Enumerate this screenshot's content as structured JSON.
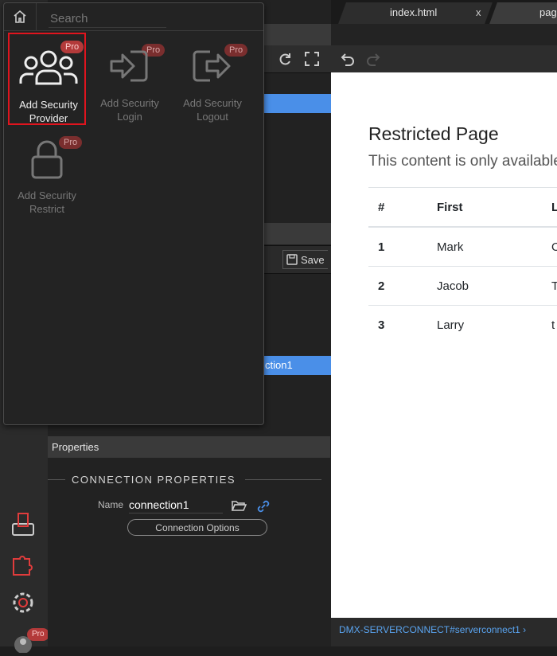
{
  "popup": {
    "search_placeholder": "Search",
    "pro_badge": "Pro",
    "tiles": [
      {
        "label_line1": "Add Security",
        "label_line2": "Provider",
        "icon": "users-icon",
        "active": true
      },
      {
        "label_line1": "Add Security",
        "label_line2": "Login",
        "icon": "login-icon",
        "active": false
      },
      {
        "label_line1": "Add Security",
        "label_line2": "Logout",
        "icon": "logout-icon",
        "active": false
      },
      {
        "label_line1": "Add Security",
        "label_line2": "Restrict",
        "icon": "lock-icon",
        "active": false
      }
    ]
  },
  "tabs": [
    {
      "label": "index.html",
      "close": "x"
    },
    {
      "label": "pag"
    }
  ],
  "background": {
    "save_label": "Save",
    "selected_item": "ction1"
  },
  "properties": {
    "header": "Properties",
    "section_title": "CONNECTION PROPERTIES",
    "name_label": "Name",
    "name_value": "connection1",
    "options_button": "Connection Options"
  },
  "canvas": {
    "heading": "Restricted Page",
    "lead": "This content is only available",
    "columns": [
      "#",
      "First",
      "L"
    ],
    "rows": [
      [
        "1",
        "Mark",
        "O"
      ],
      [
        "2",
        "Jacob",
        "T"
      ],
      [
        "3",
        "Larry",
        "t"
      ]
    ]
  },
  "status_bar": {
    "path": "DMX-SERVERCONNECT#serverconnect1 ›"
  },
  "colors": {
    "selection": "#4a8fe8",
    "pro_badge": "#b33a3a",
    "highlight_border": "#e0141e",
    "link": "#5aa4f0"
  }
}
